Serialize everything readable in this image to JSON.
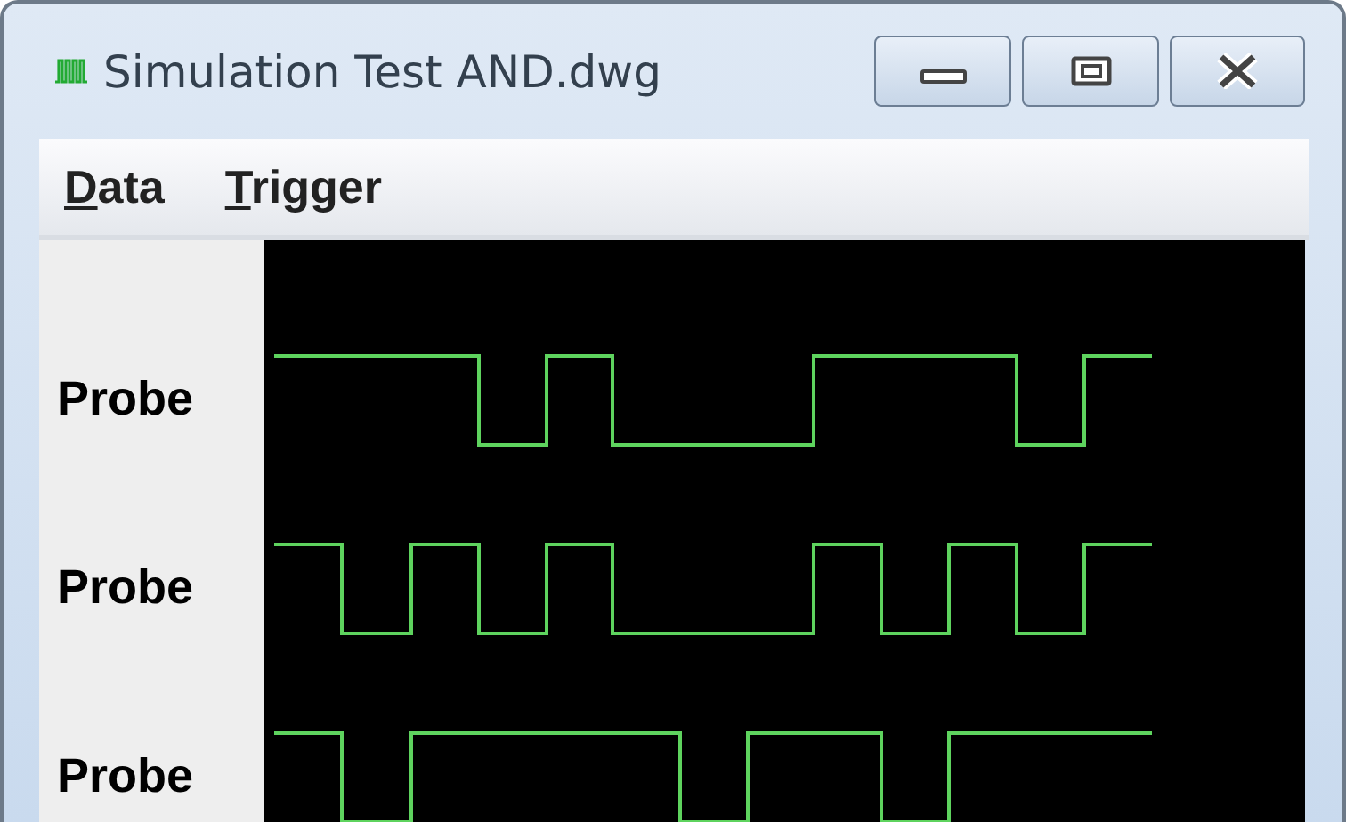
{
  "window": {
    "title": "Simulation Test AND.dwg"
  },
  "menu": [
    "Data",
    "Trigger"
  ],
  "probes": [
    {
      "label": "Probe"
    },
    {
      "label": "Probe"
    },
    {
      "label": "Probe"
    }
  ]
}
